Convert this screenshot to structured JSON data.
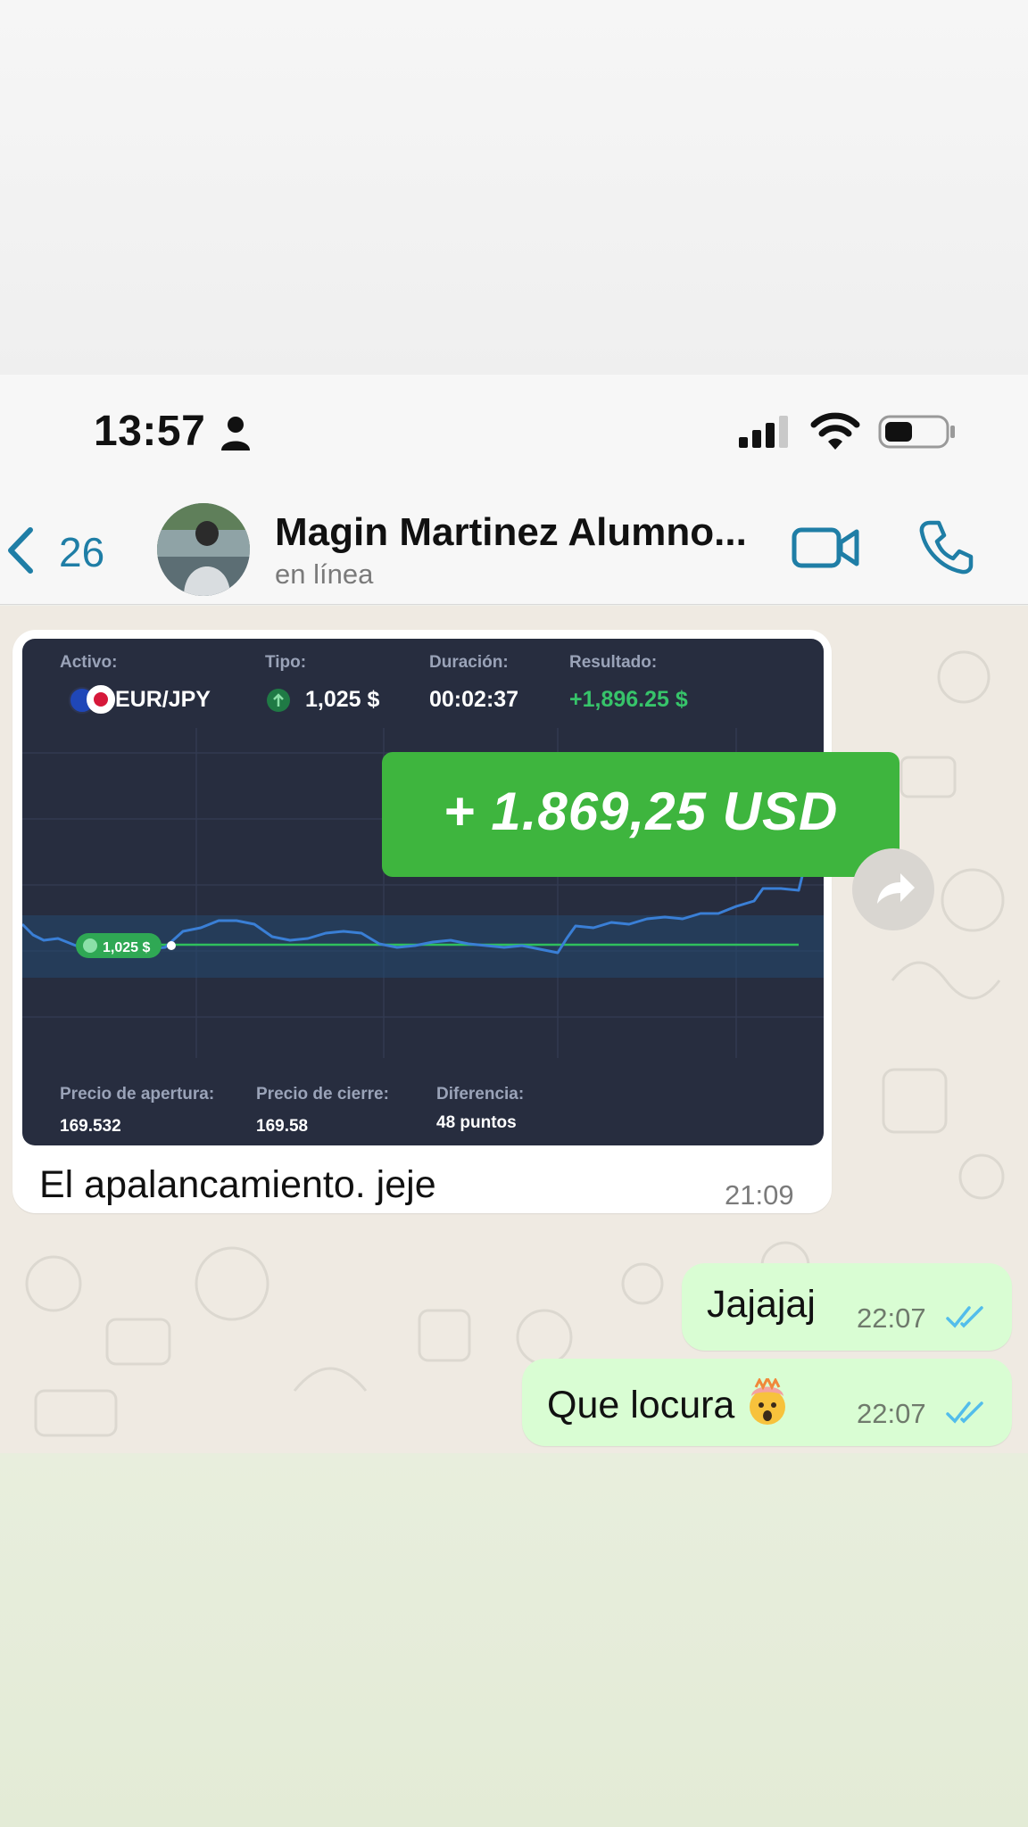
{
  "status_bar": {
    "time": "13:57",
    "icons": [
      "person-icon",
      "signal-icon",
      "wifi-icon",
      "battery-icon"
    ]
  },
  "header": {
    "back_count": "26",
    "contact_name": "Magin Martinez Alumno...",
    "contact_status": "en línea",
    "icons": [
      "chevron-left-icon",
      "video-call-icon",
      "phone-icon"
    ]
  },
  "messages": {
    "incoming": {
      "caption": "El apalancamiento. jeje",
      "time": "21:09",
      "trade_card": {
        "activo_label": "Activo:",
        "activo_value": "EUR/JPY",
        "tipo_label": "Tipo:",
        "tipo_value": "1,025 $",
        "duracion_label": "Duración:",
        "duracion_value": "00:02:37",
        "resultado_label": "Resultado:",
        "resultado_value": "+1,896.25 $",
        "entry_marker": "1,025 $",
        "apertura_label": "Precio de apertura:",
        "apertura_value": "169.532",
        "cierre_label": "Precio de cierre:",
        "cierre_value": "169.58",
        "diferencia_label": "Diferencia:",
        "diferencia_value": "48 puntos"
      },
      "banner": "+ 1.869,25 USD"
    },
    "outgoing": [
      {
        "text": "Jajajaj",
        "time": "22:07",
        "status": "read"
      },
      {
        "text": "Que locura",
        "emoji": "exploding-head-emoji",
        "time": "22:07",
        "status": "read"
      }
    ]
  },
  "colors": {
    "accent_blue": "#1f7ea6",
    "outgoing_bubble": "#d9fdd3",
    "trade_card_bg": "#272d3f",
    "banner_green": "#3eb53e",
    "profit_green": "#37c46a",
    "read_ticks": "#53bdeb"
  }
}
